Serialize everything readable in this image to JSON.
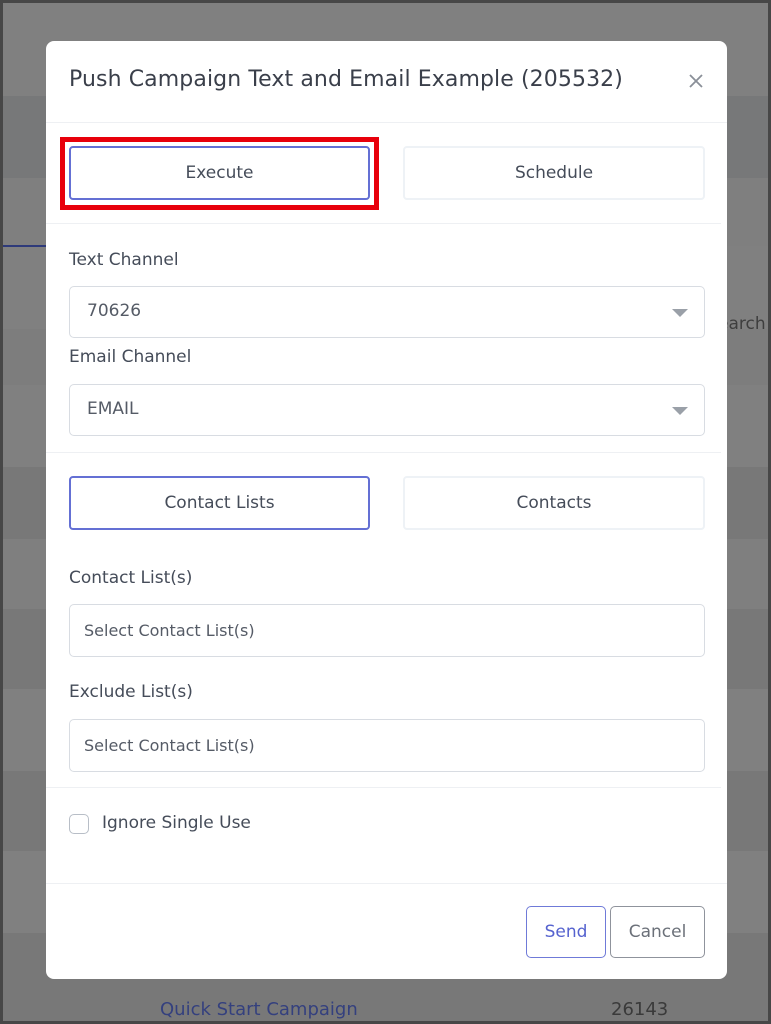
{
  "modal": {
    "title": "Push Campaign Text and Email Example (205532)",
    "close_icon": "close-icon",
    "mode_tabs": [
      {
        "label": "Execute",
        "active": true
      },
      {
        "label": "Schedule",
        "active": false
      }
    ],
    "text_channel": {
      "label": "Text Channel",
      "value": "70626"
    },
    "email_channel": {
      "label": "Email Channel",
      "value": "EMAIL"
    },
    "target_tabs": [
      {
        "label": "Contact Lists",
        "active": true
      },
      {
        "label": "Contacts",
        "active": false
      }
    ],
    "contact_lists": {
      "label": "Contact List(s)",
      "placeholder": "Select Contact List(s)"
    },
    "exclude_lists": {
      "label": "Exclude List(s)",
      "placeholder": "Select Contact List(s)"
    },
    "ignore_single_use": {
      "label": "Ignore Single Use",
      "checked": false
    },
    "footer": {
      "send_label": "Send",
      "cancel_label": "Cancel"
    }
  },
  "background": {
    "search_fragment": "earch",
    "row": {
      "name": "Quick Start Campaign",
      "value": "26143"
    }
  },
  "colors": {
    "accent": "#6470d4",
    "highlight": "#e8000b",
    "overlay": "#808080"
  }
}
